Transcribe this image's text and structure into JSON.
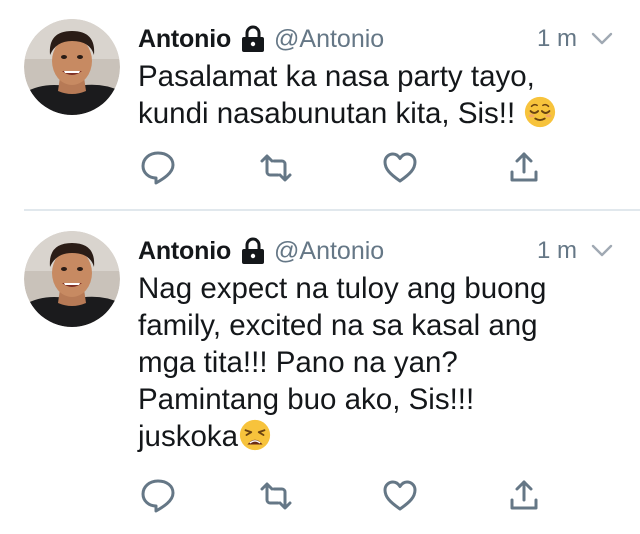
{
  "tweets": [
    {
      "author_name": "Antonio",
      "handle": "@Antonio",
      "time": "1 m",
      "text": "Pasalamat ka nasa party tayo, kundi nasabunutan kita, Sis!!",
      "emoji": "relieved-face"
    },
    {
      "author_name": "Antonio",
      "handle": "@Antonio",
      "time": "1 m",
      "text_lines": [
        "Nag expect na tuloy ang buong",
        "family, excited na sa kasal ang",
        "mga tita!!! Pano na yan?",
        "Pamintang buo ako, Sis!!!",
        "juskoka"
      ],
      "emoji": "weary-face"
    }
  ],
  "icons": {
    "protected": "lock-icon",
    "more": "chevron-down-icon",
    "reply": "reply-icon",
    "retweet": "retweet-icon",
    "like": "heart-icon",
    "share": "share-icon"
  },
  "colors": {
    "text": "#14171a",
    "secondary": "#657786",
    "divider": "#e1e8ed"
  }
}
